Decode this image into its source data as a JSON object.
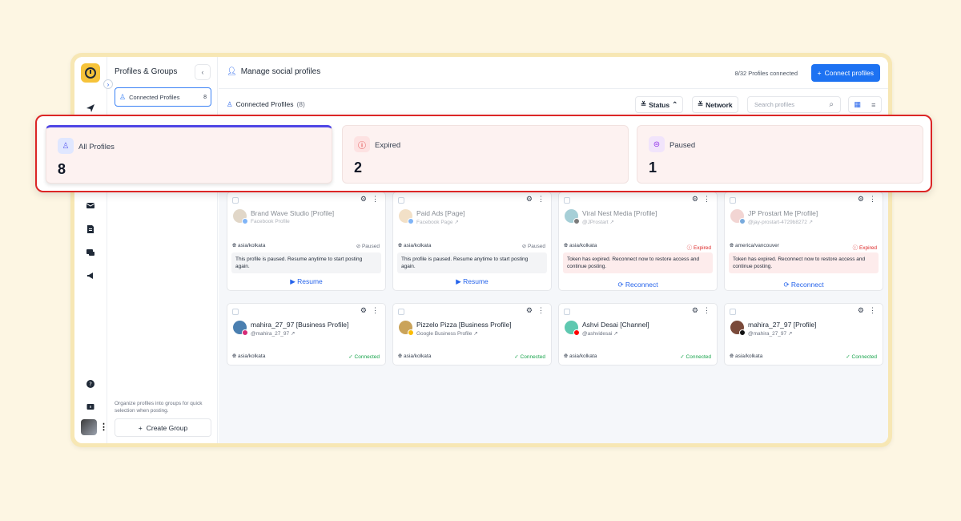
{
  "app": {
    "pg_title": "Profiles & Groups",
    "connected_profiles_label": "Connected Profiles",
    "connected_profiles_count": "8",
    "help_text": "Organize profiles into groups for quick selection when posting.",
    "create_group_label": "Create Group"
  },
  "header": {
    "title": "Manage social profiles",
    "profiles_connected": "8/32 Profiles connected",
    "connect_button": "Connect profiles"
  },
  "subbar": {
    "title": "Connected Profiles",
    "count": "(8)",
    "status_label": "Status",
    "network_label": "Network",
    "search_placeholder": "Search profiles"
  },
  "stats": [
    {
      "label": "All Profiles",
      "value": "8",
      "icon": "user-icon",
      "color": "#6366f1"
    },
    {
      "label": "Expired",
      "value": "2",
      "icon": "alert-circle-icon",
      "color": "#dc2626"
    },
    {
      "label": "Paused",
      "value": "1",
      "icon": "pause-circle-icon",
      "color": "#9333ea"
    }
  ],
  "cards": [
    {
      "name": "Brand Wave Studio [Profile]",
      "sub": "Facebook Profile",
      "tz": "asia/kolkata",
      "status": "Paused",
      "message": "This profile is paused. Resume anytime to start posting again.",
      "action": "Resume",
      "network": "facebook"
    },
    {
      "name": "Paid Ads [Page]",
      "sub": "Facebook Page",
      "tz": "asia/kolkata",
      "status": "Paused",
      "message": "This profile is paused. Resume anytime to start posting again.",
      "action": "Resume",
      "network": "facebook"
    },
    {
      "name": "Viral Nest Media [Profile]",
      "sub": "@JProstart",
      "tz": "asia/kolkata",
      "status": "Expired",
      "message": "Token has expired. Reconnect now to restore access and continue posting.",
      "action": "Reconnect",
      "network": "x"
    },
    {
      "name": "JP Prostart Me [Profile]",
      "sub": "@jay-prostart-4729b8272",
      "tz": "america/vancouver",
      "status": "Expired",
      "message": "Token has expired. Reconnect now to restore access and continue posting.",
      "action": "Reconnect",
      "network": "linkedin"
    },
    {
      "name": "mahira_27_97 [Business Profile]",
      "sub": "@mahira_27_97",
      "tz": "asia/kolkata",
      "status": "Connected",
      "network": "instagram"
    },
    {
      "name": "Pizzelo Pizza [Business Profile]",
      "sub": "Google Business Profile",
      "tz": "asia/kolkata",
      "status": "Connected",
      "network": "google"
    },
    {
      "name": "Ashvi Desai [Channel]",
      "sub": "@ashvidesai",
      "tz": "asia/kolkata",
      "status": "Connected",
      "network": "youtube"
    },
    {
      "name": "mahira_27_97 [Profile]",
      "sub": "@mahira_27_97",
      "tz": "asia/kolkata",
      "status": "Connected",
      "network": "threads"
    }
  ],
  "colors": {
    "accent": "#1d72f2",
    "highlight": "#dc2626",
    "brand": "#f6c33a"
  }
}
